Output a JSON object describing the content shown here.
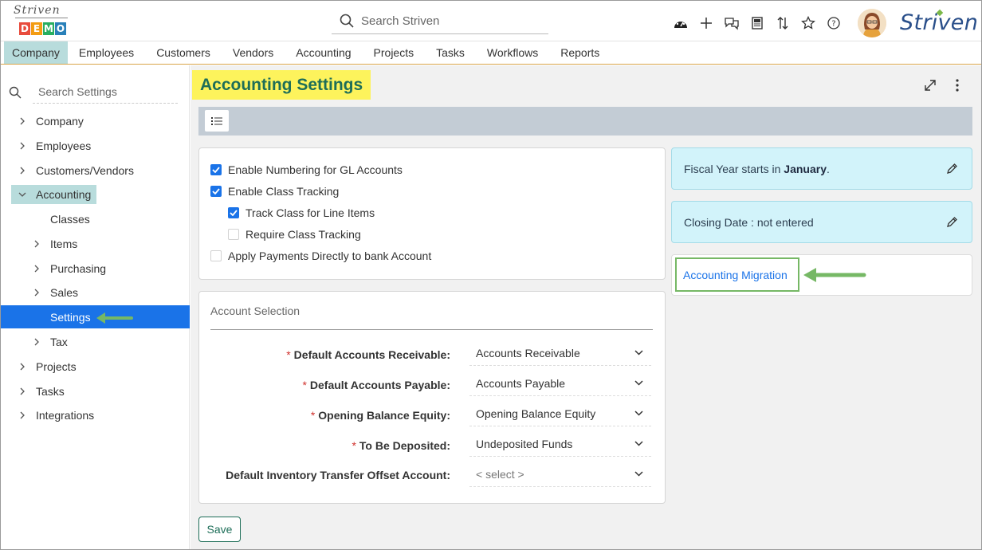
{
  "app": {
    "logo_script": "Striven",
    "logo_demo": [
      "D",
      "E",
      "M",
      "O"
    ],
    "logo_demo_colors": [
      "#e84c3d",
      "#f39c12",
      "#27ae60",
      "#2980b9"
    ],
    "brand": "Striven"
  },
  "header": {
    "search_placeholder": "Search Striven",
    "icons": [
      "dashboard-icon",
      "plus-icon",
      "chat-icon",
      "news-icon",
      "sort-arrows-icon",
      "star-icon",
      "help-icon"
    ]
  },
  "nav": {
    "tabs": [
      "Company",
      "Employees",
      "Customers",
      "Vendors",
      "Accounting",
      "Projects",
      "Tasks",
      "Workflows",
      "Reports"
    ],
    "active": "Company"
  },
  "sidebar": {
    "search_placeholder": "Search Settings",
    "items": [
      {
        "label": "Company",
        "level": 0,
        "chevron": "right"
      },
      {
        "label": "Employees",
        "level": 0,
        "chevron": "right"
      },
      {
        "label": "Customers/Vendors",
        "level": 0,
        "chevron": "right"
      },
      {
        "label": "Accounting",
        "level": 0,
        "chevron": "down"
      },
      {
        "label": "Classes",
        "level": 1,
        "chevron": "none"
      },
      {
        "label": "Items",
        "level": 1,
        "chevron": "right"
      },
      {
        "label": "Purchasing",
        "level": 1,
        "chevron": "right"
      },
      {
        "label": "Sales",
        "level": 1,
        "chevron": "right"
      },
      {
        "label": "Settings",
        "level": 1,
        "chevron": "none"
      },
      {
        "label": "Tax",
        "level": 1,
        "chevron": "right"
      },
      {
        "label": "Projects",
        "level": 0,
        "chevron": "right"
      },
      {
        "label": "Tasks",
        "level": 0,
        "chevron": "right"
      },
      {
        "label": "Integrations",
        "level": 0,
        "chevron": "right"
      }
    ],
    "selected": "Settings"
  },
  "page": {
    "title": "Accounting Settings"
  },
  "options": [
    {
      "label": "Enable Numbering for GL Accounts",
      "checked": true
    },
    {
      "label": "Enable Class Tracking",
      "checked": true
    },
    {
      "label": "Track Class for Line Items",
      "checked": true
    },
    {
      "label": "Require Class Tracking",
      "checked": false
    },
    {
      "label": "Apply Payments Directly to bank Account",
      "checked": false
    }
  ],
  "account_selection": {
    "title": "Account Selection",
    "fields": [
      {
        "label": "Default Accounts Receivable:",
        "value": "Accounts Receivable",
        "required": true
      },
      {
        "label": "Default Accounts Payable:",
        "value": "Accounts Payable",
        "required": true
      },
      {
        "label": "Opening Balance Equity:",
        "value": "Opening Balance Equity",
        "required": true
      },
      {
        "label": "To Be Deposited:",
        "value": "Undeposited Funds",
        "required": true
      },
      {
        "label": "Default Inventory Transfer Offset Account:",
        "value": "< select >",
        "required": false
      }
    ]
  },
  "fiscal": {
    "prefix": "Fiscal Year starts in ",
    "month": "January",
    "suffix": "."
  },
  "closing": {
    "label": "Closing Date :",
    "value": "not entered"
  },
  "migration_link": "Accounting Migration",
  "save_label": "Save",
  "colors": {
    "accent": "#1a73e8",
    "title_highlight": "#fdf35c",
    "title_text": "#1e6e58",
    "arrow": "#76b865",
    "nav_active": "#b8dcdc",
    "info_bg": "#d2f3fa"
  }
}
